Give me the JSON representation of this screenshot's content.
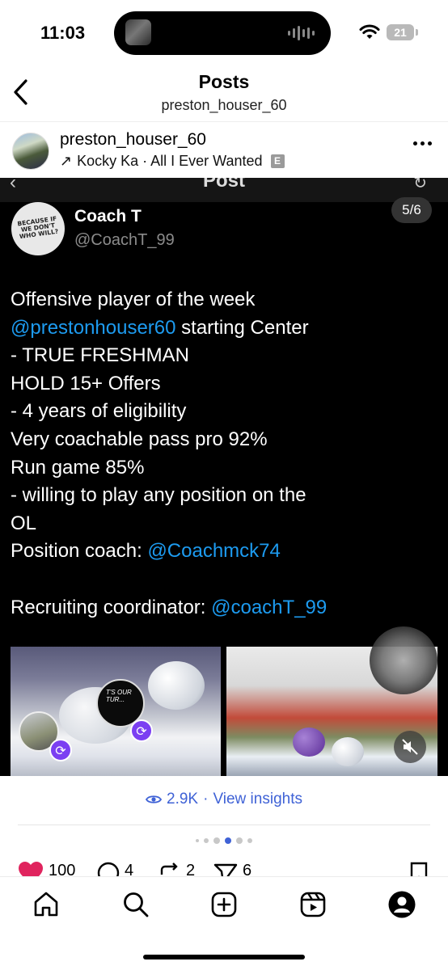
{
  "status_bar": {
    "time": "11:03",
    "battery": "21"
  },
  "header": {
    "title": "Posts",
    "subtitle": "preston_houser_60"
  },
  "post": {
    "author": "preston_houser_60",
    "music_prefix": "↗",
    "music": "Kocky Ka · All I Ever Wanted",
    "explicit_label": "E"
  },
  "tweet": {
    "screen_title": "Post",
    "name": "Coach T",
    "handle": "@CoachT_99",
    "counter": "5/6",
    "avatar_shirt_text": "BECAUSE IF WE DON'T WHO WILL?",
    "lines": [
      {
        "text": "Offensive player of the week"
      },
      {
        "link": "@prestonhouser60",
        "text": " starting Center"
      },
      {
        "text": "- TRUE FRESHMAN"
      },
      {
        "text": "HOLD 15+ Offers"
      },
      {
        "text": "- 4 years of eligibility"
      },
      {
        "text": "Very coachable pass pro 92%"
      },
      {
        "text": "Run game 85%"
      },
      {
        "text": "- willing to play any position on the"
      },
      {
        "text": "OL"
      },
      {
        "text": "Position coach:  ",
        "link": "@Coachmck74"
      },
      {
        "text": ""
      },
      {
        "text": "Recruiting coordinator: ",
        "link": "@coachT_99"
      }
    ],
    "photo_logo_text": "T'S OUR TUR..."
  },
  "insights": {
    "views": "2.9K",
    "separator": "·",
    "link_label": "View insights"
  },
  "carousel": {
    "count": 6,
    "active_index": 3
  },
  "actions": {
    "likes": "100",
    "comments": "4",
    "reposts": "2",
    "shares": "6"
  },
  "colors": {
    "accent_blue": "#3f62d6",
    "tweet_link": "#1d9bf0",
    "like_red": "#e0245e",
    "repost_purple": "#7b3ff2"
  },
  "nav": {
    "items": [
      "home-icon",
      "search-icon",
      "create-icon",
      "reels-icon",
      "profile-icon"
    ]
  }
}
